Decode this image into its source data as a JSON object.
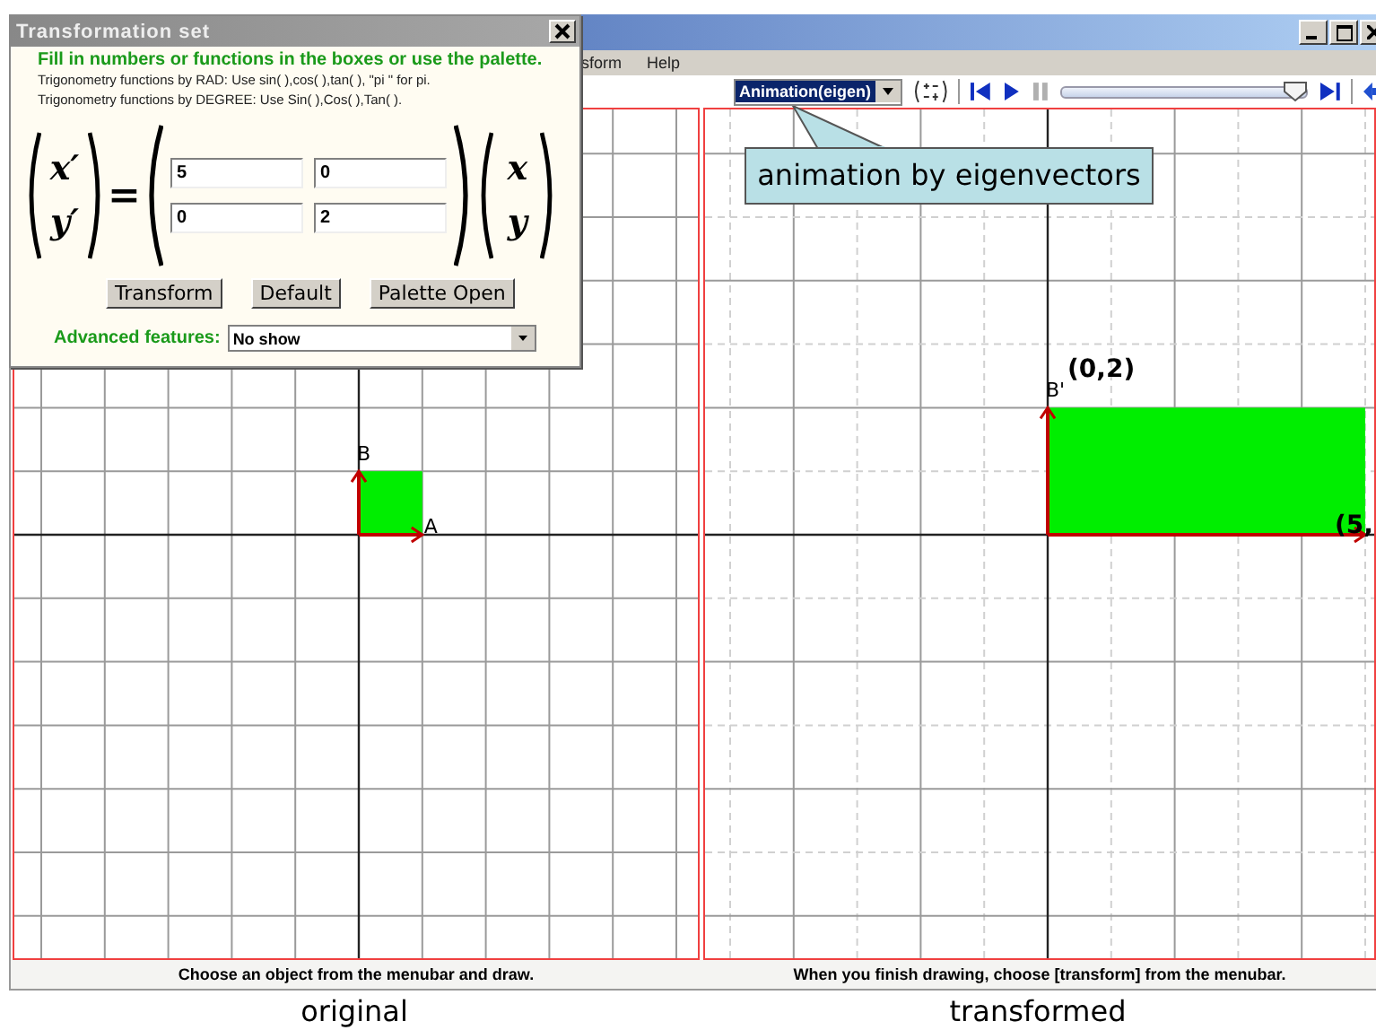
{
  "dialog": {
    "title": "Transformation set",
    "instruction": "Fill in numbers or functions in the boxes or use the palette.",
    "hints": [
      "Trigonometry functions by RAD: Use sin( ),cos( ),tan( ), \"pi \" for pi.",
      "Trigonometry functions by DEGREE: Use Sin( ),Cos( ),Tan( )."
    ],
    "formula": {
      "lhs": [
        "x′",
        "y′"
      ],
      "equals": "=",
      "matrix": [
        [
          "5",
          "0"
        ],
        [
          "0",
          "2"
        ]
      ],
      "rhs": [
        "x",
        "y"
      ]
    },
    "buttons": [
      "Transform",
      "Default",
      "Palette Open"
    ],
    "advanced": {
      "label": "Advanced features:",
      "value": "No show"
    }
  },
  "menu": [
    "sform",
    "Help"
  ],
  "toolbar": {
    "mode": "Animation(eigen)",
    "slider": {
      "level": 0.95
    }
  },
  "tooltip": "animation by eigenvectors",
  "panels": [
    {
      "status": "Choose an object from the menubar and draw.",
      "caption": "original",
      "minor_dashed": false,
      "labels": [
        {
          "text": "A",
          "kind": "x_end"
        },
        {
          "text": "B",
          "kind": "y_end"
        }
      ]
    },
    {
      "status": "When you finish drawing, choose [transform] from the menubar.",
      "caption": "transformed",
      "minor_dashed": true,
      "labels": [
        {
          "text": "B'",
          "kind": "y_end"
        },
        {
          "text": "(0,2)",
          "kind": "y_coord"
        },
        {
          "text": "(5,",
          "kind": "x_coord"
        }
      ]
    }
  ]
}
